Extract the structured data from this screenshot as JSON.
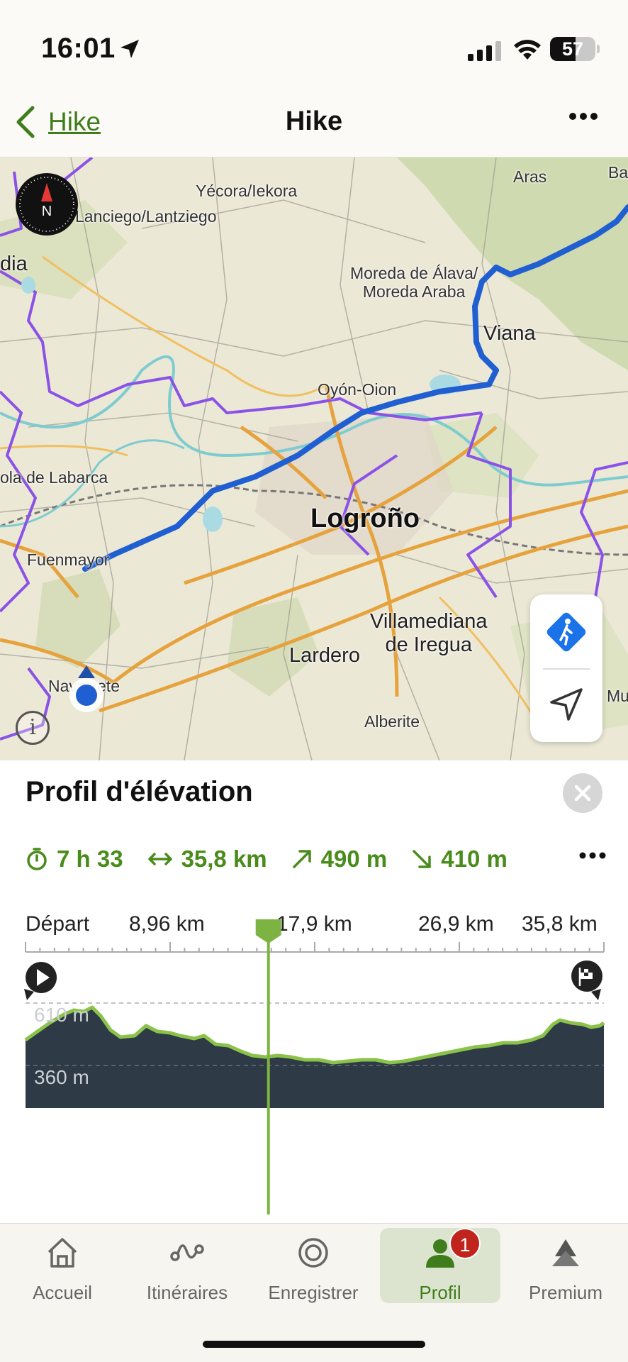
{
  "status": {
    "time": "16:01",
    "battery": "57"
  },
  "nav": {
    "back_label": "Hike",
    "title": "Hike"
  },
  "map": {
    "places": [
      {
        "key": "aras",
        "text": "Aras"
      },
      {
        "key": "ba",
        "text": "Ba"
      },
      {
        "key": "yecora",
        "text": "Yécora/Iekora"
      },
      {
        "key": "lanciego",
        "text": "Lanciego/Lantziego"
      },
      {
        "key": "dia",
        "text": "dia"
      },
      {
        "key": "moreda",
        "text": "Moreda de Álava/\nMoreda Araba"
      },
      {
        "key": "viana",
        "text": "Viana"
      },
      {
        "key": "oyon",
        "text": "Oyón-Oion"
      },
      {
        "key": "labarca",
        "text": "ola de Labarca"
      },
      {
        "key": "logrono",
        "text": "Logroño"
      },
      {
        "key": "fuenmayor",
        "text": "Fuenmayor"
      },
      {
        "key": "villamediana",
        "text": "Villamediana\nde Iregua"
      },
      {
        "key": "lardero",
        "text": "Lardero"
      },
      {
        "key": "navarrete",
        "text": "Navarrete"
      },
      {
        "key": "mu",
        "text": "Mu"
      },
      {
        "key": "alberite",
        "text": "Alberite"
      }
    ],
    "compass_letter": "N",
    "info_label": "i"
  },
  "elevation": {
    "title": "Profil d'élévation",
    "stats": {
      "duration": "7 h 33",
      "distance": "35,8 km",
      "ascent": "490 m",
      "descent": "410 m"
    },
    "distance_ticks": [
      "Départ",
      "8,96 km",
      "17,9 km",
      "26,9 km",
      "35,8 km"
    ],
    "elevation_labels": [
      "610 m",
      "360 m"
    ],
    "cursor_fraction": 0.42
  },
  "tabs": [
    {
      "label": "Accueil",
      "icon": "home-icon"
    },
    {
      "label": "Itinéraires",
      "icon": "route-icon"
    },
    {
      "label": "Enregistrer",
      "icon": "record-icon"
    },
    {
      "label": "Profil",
      "icon": "profile-icon",
      "badge": "1",
      "active": true
    },
    {
      "label": "Premium",
      "icon": "premium-icon"
    }
  ],
  "colors": {
    "accent": "#4a8c1c",
    "route": "#1f5fd1",
    "boundary": "#8a52e6",
    "profile_fill": "#2e3a46",
    "profile_line": "#8bc34a"
  }
}
